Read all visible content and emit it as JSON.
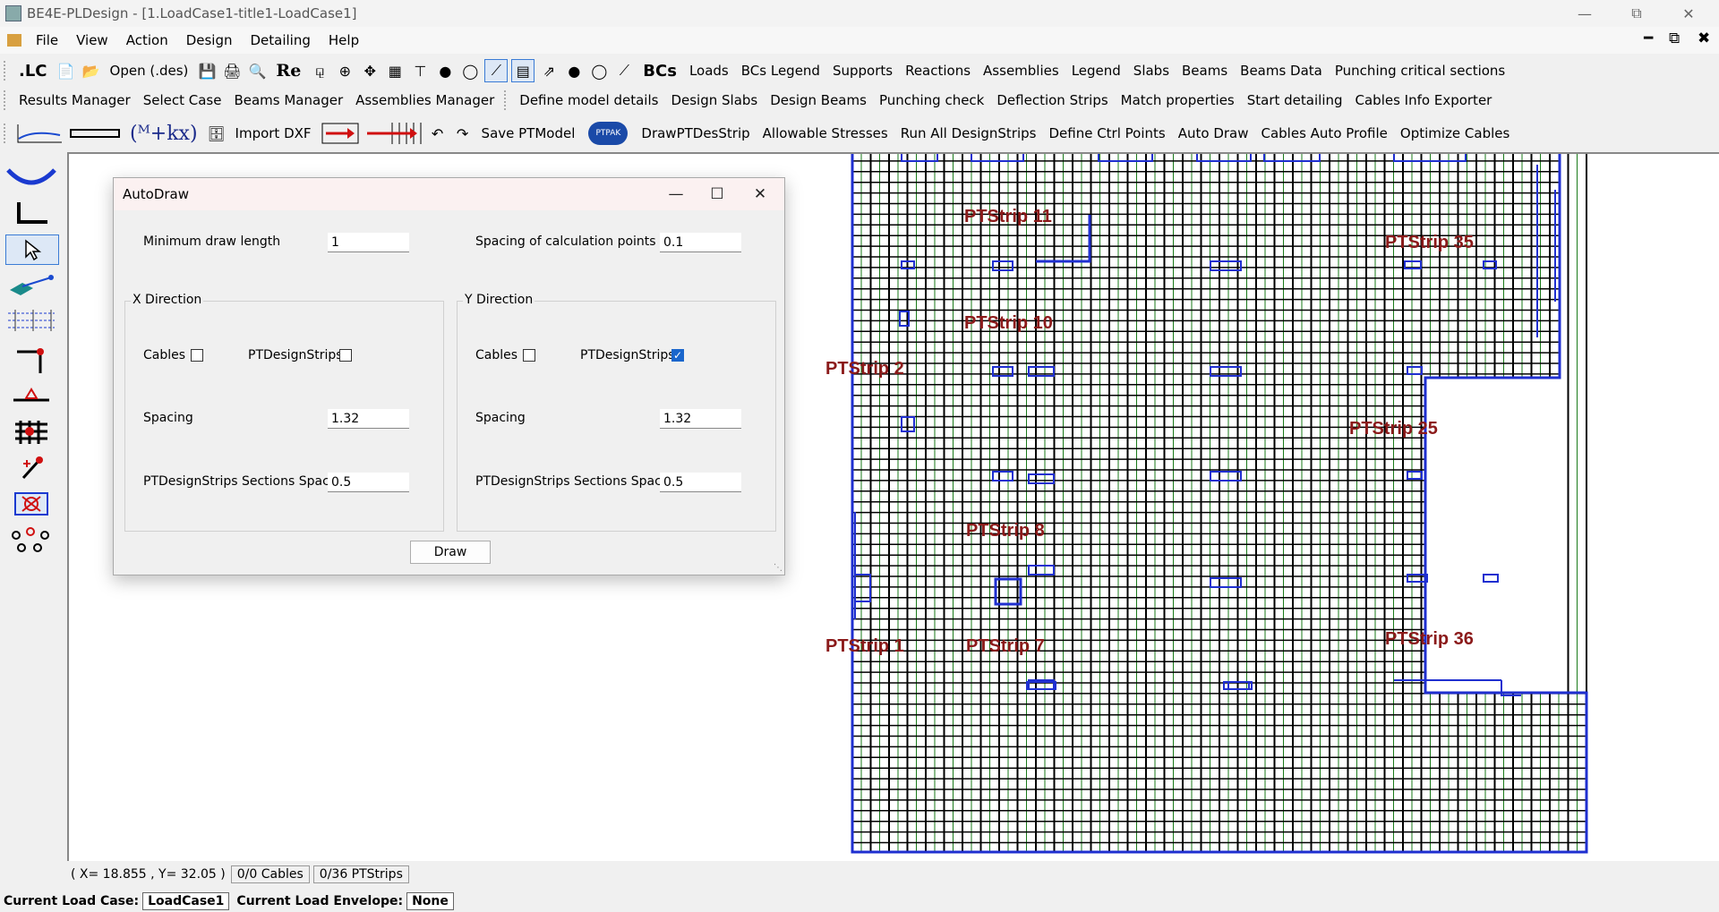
{
  "window": {
    "title": "BE4E-PLDesign - [1.LoadCase1-title1-LoadCase1]"
  },
  "menu": [
    "File",
    "View",
    "Action",
    "Design",
    "Detailing",
    "Help"
  ],
  "toolbar1": {
    "lc_label": ".LC",
    "open_label": "Open (.des)",
    "re_label": "Re",
    "bcs_label": "BCs",
    "items": [
      "Loads",
      "BCs Legend",
      "Supports",
      "Reactions",
      "Assemblies",
      "Legend",
      "Slabs",
      "Beams",
      "Beams Data",
      "Punching critical sections"
    ]
  },
  "toolbar2": {
    "group1": [
      "Results Manager",
      "Select Case",
      "Beams Manager",
      "Assemblies Manager"
    ],
    "group2": [
      "Define model details",
      "Design Slabs",
      "Design Beams",
      "Punching check",
      "Deflection Strips",
      "Match properties",
      "Start detailing",
      "Cables Info Exporter"
    ]
  },
  "toolbar3": {
    "formula_label": "(ᴹ+kx)",
    "import_dxf": "Import DXF",
    "save_ptmodel": "Save PTModel",
    "ptpak_label": "PTPAK",
    "items": [
      "DrawPTDesStrip",
      "Allowable Stresses",
      "Run All DesignStrips",
      "Define Ctrl Points",
      "Auto Draw",
      "Cables Auto Profile",
      "Optimize Cables"
    ]
  },
  "dialog": {
    "title": "AutoDraw",
    "min_draw_length_label": "Minimum draw length",
    "min_draw_length_value": "1",
    "spacing_calc_label": "Spacing of calculation points",
    "spacing_calc_value": "0.1",
    "x": {
      "title": "X Direction",
      "cables_label": "Cables",
      "cables_checked": false,
      "strips_label": "PTDesignStrips",
      "strips_checked": false,
      "spacing_label": "Spacing",
      "spacing_value": "1.32",
      "sections_label": "PTDesignStrips Sections Spacing",
      "sections_value": "0.5"
    },
    "y": {
      "title": "Y Direction",
      "cables_label": "Cables",
      "cables_checked": false,
      "strips_label": "PTDesignStrips",
      "strips_checked": true,
      "spacing_label": "Spacing",
      "spacing_value": "1.32",
      "sections_label": "PTDesignStrips Sections Spacing",
      "sections_value": "0.5"
    },
    "draw_button": "Draw"
  },
  "strip_labels": {
    "s11": "PTStrip 11",
    "s35": "PTStrip 35",
    "s10": "PTStrip 10",
    "s2": "PTStrip 2",
    "s25": "PTStrip 25",
    "s8": "PTStrip 8",
    "s1": "PTStrip 1",
    "s7": "PTStrip 7",
    "s36": "PTStrip 36"
  },
  "status": {
    "coords": "( X= 18.855 , Y= 32.05 )",
    "cables": "0/0 Cables",
    "strips": "0/36 PTStrips"
  },
  "bottom": {
    "load_case_label": "Current Load Case:",
    "load_case_value": "LoadCase1",
    "envelope_label": "Current Load Envelope:",
    "envelope_value": "None"
  },
  "colors": {
    "strip_label": "#8b1a1a",
    "grid_black": "#000000",
    "grid_green": "#1a7a1a",
    "outline_blue": "#1f2fd0",
    "accent": "#1a66cc"
  }
}
